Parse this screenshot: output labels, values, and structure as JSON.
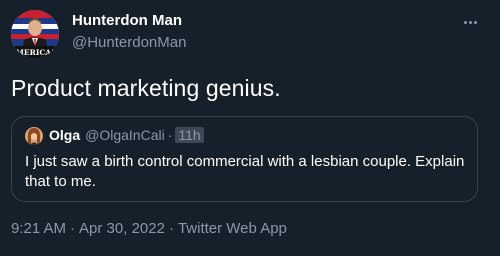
{
  "author": {
    "display_name": "Hunterdon Man",
    "handle": "@HunterdonMan",
    "avatar_caption": "MERICA!"
  },
  "tweet": {
    "text": "Product marketing genius."
  },
  "quoted_tweet": {
    "display_name": "Olga",
    "handle": "@OlgaInCali",
    "separator": "·",
    "time": "11h",
    "text": "I just saw a birth control commercial with a lesbian couple. Explain that to me."
  },
  "meta": {
    "time": "9:21 AM",
    "separator": "·",
    "date": "Apr 30, 2022",
    "source": "Twitter Web App"
  },
  "colors": {
    "background": "#15202b",
    "secondary_text": "#8b98a5",
    "border": "#38444d"
  },
  "icons": {
    "more": "more-horizontal-icon"
  }
}
